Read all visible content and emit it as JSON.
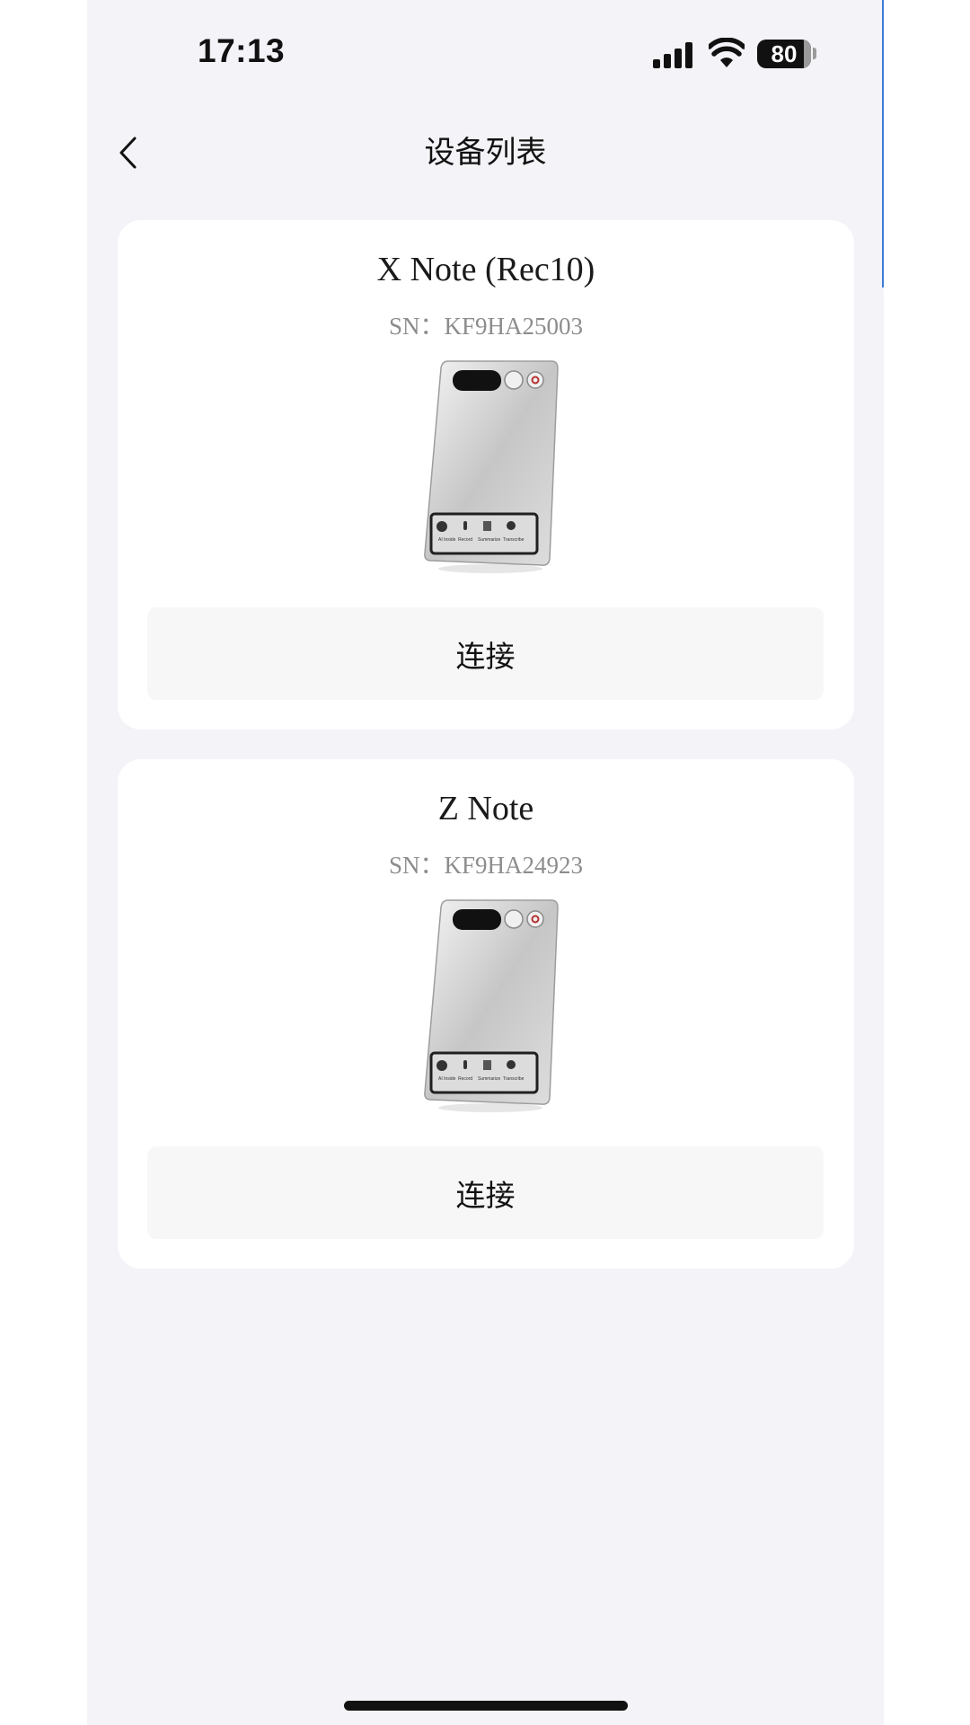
{
  "status_bar": {
    "time": "17:13",
    "battery_level": "80",
    "icons": [
      "signal-icon",
      "wifi-icon",
      "battery-icon"
    ]
  },
  "header": {
    "title": "设备列表",
    "back_icon": "chevron-left-icon"
  },
  "devices": [
    {
      "name": "X Note (Rec10)",
      "sn": "SN：KF9HA25003",
      "connect_label": "连接"
    },
    {
      "name": "Z Note",
      "sn": "SN：KF9HA24923",
      "connect_label": "连接"
    }
  ],
  "device_image_labels": [
    "AI Inside",
    "Record",
    "Summarize",
    "Transcribe"
  ],
  "colors": {
    "background": "#f3f3f8",
    "card": "#ffffff",
    "button": "#f7f7f7",
    "text": "#111111",
    "sn_text": "#8d8d8d"
  }
}
